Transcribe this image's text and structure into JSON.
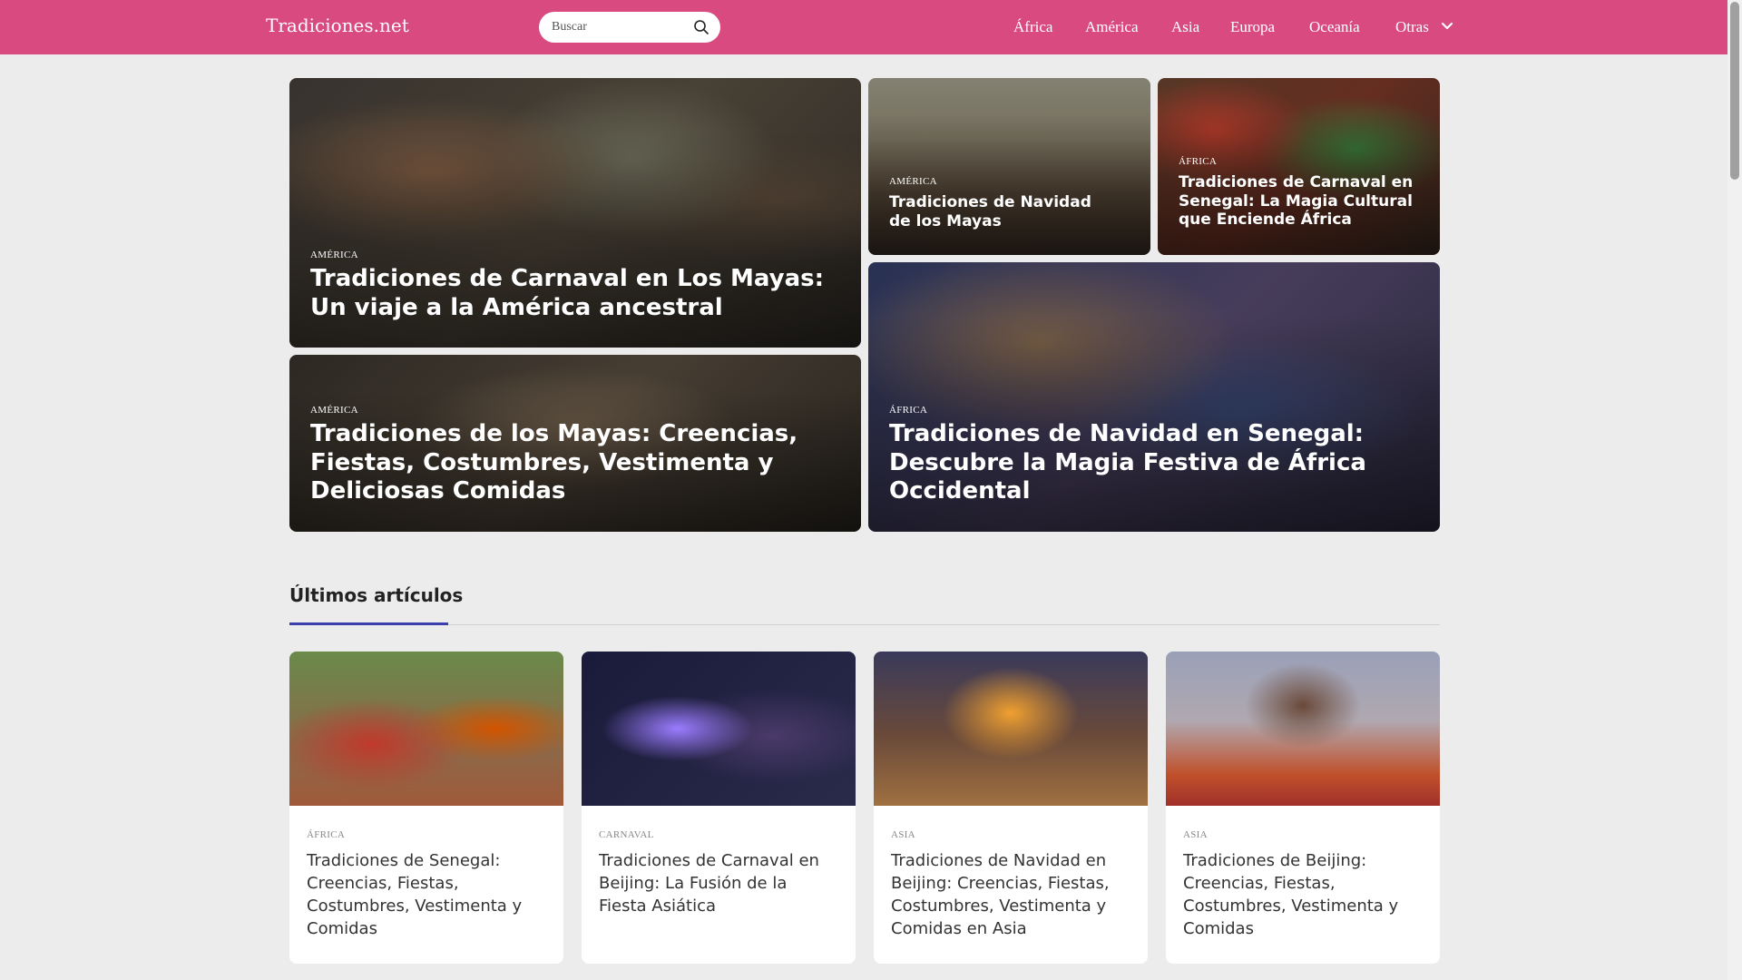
{
  "header": {
    "brand": "Tradiciones.net",
    "search_placeholder": "Buscar",
    "nav": [
      "África",
      "América",
      "Asia",
      "Europa",
      "Oceanía",
      "Otras"
    ]
  },
  "hero": [
    {
      "category": "AMÉRICA",
      "title": "Tradiciones de Carnaval en Los Mayas: Un viaje a la América ancestral"
    },
    {
      "category": "AMÉRICA",
      "title": "Tradiciones de Navidad de los Mayas"
    },
    {
      "category": "ÁFRICA",
      "title": "Tradiciones de Carnaval en Senegal: La Magia Cultural que Enciende África"
    },
    {
      "category": "AMÉRICA",
      "title": "Tradiciones de los Mayas: Creencias, Fiestas, Costumbres, Vestimenta y Deliciosas Comidas"
    },
    {
      "category": "ÁFRICA",
      "title": "Tradiciones de Navidad en Senegal: Descubre la Magia Festiva de África Occidental"
    }
  ],
  "latest": {
    "heading": "Últimos artículos",
    "cards": [
      {
        "category": "ÁFRICA",
        "title": "Tradiciones de Senegal: Creencias, Fiestas, Costumbres, Vestimenta y Comidas"
      },
      {
        "category": "CARNAVAL",
        "title": "Tradiciones de Carnaval en Beijing: La Fusión de la Fiesta Asiática"
      },
      {
        "category": "ASIA",
        "title": "Tradiciones de Navidad en Beijing: Creencias, Fiestas, Costumbres, Vestimenta y Comidas en Asia"
      },
      {
        "category": "ASIA",
        "title": "Tradiciones de Beijing: Creencias, Fiestas, Costumbres, Vestimenta y Comidas"
      }
    ]
  },
  "colors": {
    "header_bg": "#d84a80",
    "accent_underline": "#3b3fae",
    "page_bg": "#ececec"
  }
}
